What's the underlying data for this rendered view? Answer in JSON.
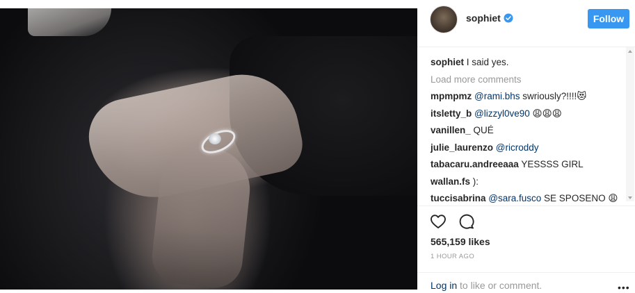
{
  "post": {
    "username": "sophiet",
    "follow_label": "Follow",
    "caption_user": "sophiet",
    "caption_text": "I said yes.",
    "load_more": "Load more comments",
    "comments": [
      {
        "user": "mpmpmz",
        "mention": "@rami.bhs",
        "text": "swriously?!!!!😻"
      },
      {
        "user": "itsletty_b",
        "mention": "@lizzyl0ve90",
        "text": "😩😩😩"
      },
      {
        "user": "vanillen_",
        "mention": "",
        "text": "QUÉ"
      },
      {
        "user": "julie_laurenzo",
        "mention": "@ricroddy",
        "text": ""
      },
      {
        "user": "tabacaru.andreeaaa",
        "mention": "",
        "text": "YESSSS GIRL"
      },
      {
        "user": "wallan.fs",
        "mention": "",
        "text": "):"
      },
      {
        "user": "tuccisabrina",
        "mention": "@sara.fusco",
        "text": "SE SPOSENO 😩"
      }
    ],
    "likes": "565,159 likes",
    "timestamp": "1 HOUR AGO",
    "login_link": "Log in",
    "login_rest": "to like or comment.",
    "more_glyph": "•••"
  },
  "icons": {
    "verified": "verified-badge-icon",
    "heart": "heart-icon",
    "comment": "comment-bubble-icon",
    "more": "more-options-icon"
  },
  "colors": {
    "accent": "#3897f0",
    "mention": "#003569",
    "muted": "#999999"
  }
}
